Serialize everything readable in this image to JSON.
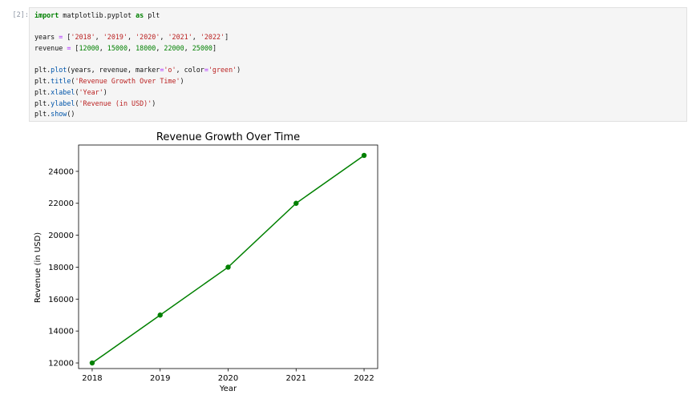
{
  "cell": {
    "prompt": "[2]:",
    "code": {
      "l1": {
        "kw1": "import",
        "mod": " matplotlib.pyplot ",
        "kw2": "as",
        "alias": " plt"
      },
      "l3": {
        "a": "years ",
        "op": "=",
        "b": " [",
        "s1": "'2018'",
        "c1": ", ",
        "s2": "'2019'",
        "c2": ", ",
        "s3": "'2020'",
        "c3": ", ",
        "s4": "'2021'",
        "c4": ", ",
        "s5": "'2022'",
        "e": "]"
      },
      "l4": {
        "a": "revenue ",
        "op": "=",
        "b": " [",
        "n1": "12000",
        "c1": ", ",
        "n2": "15000",
        "c2": ", ",
        "n3": "18000",
        "c3": ", ",
        "n4": "22000",
        "c4": ", ",
        "n5": "25000",
        "e": "]"
      },
      "l6": {
        "obj": "plt.",
        "fn": "plot",
        "a": "(years, revenue, marker",
        "op1": "=",
        "s1": "'o'",
        "b": ", color",
        "op2": "=",
        "s2": "'green'",
        "e": ")"
      },
      "l7": {
        "obj": "plt.",
        "fn": "title",
        "a": "(",
        "s": "'Revenue Growth Over Time'",
        "e": ")"
      },
      "l8": {
        "obj": "plt.",
        "fn": "xlabel",
        "a": "(",
        "s": "'Year'",
        "e": ")"
      },
      "l9": {
        "obj": "plt.",
        "fn": "ylabel",
        "a": "(",
        "s": "'Revenue (in USD)'",
        "e": ")"
      },
      "l10": {
        "obj": "plt.",
        "fn": "show",
        "e": "()"
      }
    }
  },
  "chart_data": {
    "type": "line",
    "title": "Revenue Growth Over Time",
    "xlabel": "Year",
    "ylabel": "Revenue (in USD)",
    "categories": [
      "2018",
      "2019",
      "2020",
      "2021",
      "2022"
    ],
    "series": [
      {
        "values": [
          12000,
          15000,
          18000,
          22000,
          25000
        ],
        "color": "#008000",
        "marker": "o"
      }
    ],
    "yticks": [
      12000,
      14000,
      16000,
      18000,
      20000,
      22000,
      24000
    ],
    "ylim": [
      11650,
      25650
    ],
    "grid": false
  }
}
